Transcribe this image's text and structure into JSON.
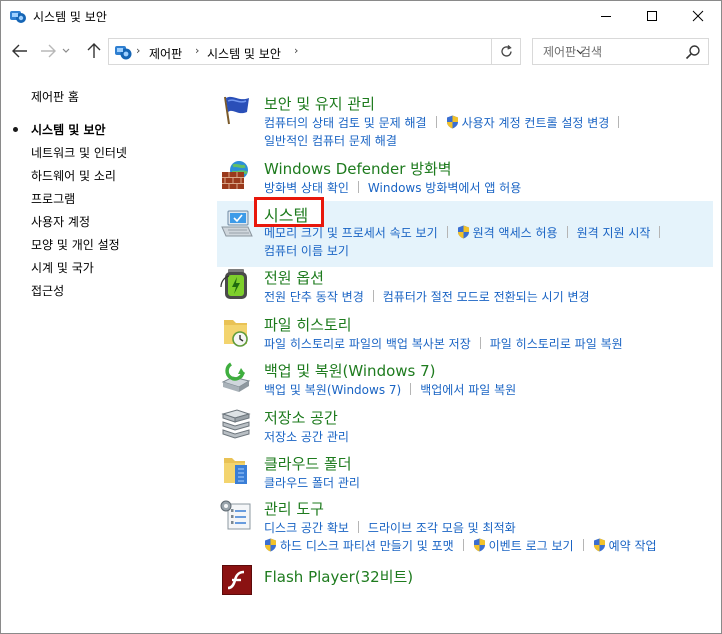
{
  "window": {
    "title": "시스템 및 보안"
  },
  "address": {
    "breadcrumbs": [
      "제어판",
      "시스템 및 보안"
    ],
    "search_placeholder": "제어판 검색"
  },
  "leftnav": {
    "items": [
      {
        "label": "제어판 홈",
        "current": false
      },
      {
        "label": "시스템 및 보안",
        "current": true
      },
      {
        "label": "네트워크 및 인터넷",
        "current": false
      },
      {
        "label": "하드웨어 및 소리",
        "current": false
      },
      {
        "label": "프로그램",
        "current": false
      },
      {
        "label": "사용자 계정",
        "current": false
      },
      {
        "label": "모양 및 개인 설정",
        "current": false
      },
      {
        "label": "시계 및 국가",
        "current": false
      },
      {
        "label": "접근성",
        "current": false
      }
    ]
  },
  "categories": [
    {
      "title": "보안 및 유지 관리",
      "icon": "flag-icon",
      "links": [
        [
          "컴퓨터의 상태 검토 및 문제 해결",
          "사용자 계정 컨트롤 설정 변경"
        ],
        [
          "일반적인 컴퓨터 문제 해결"
        ]
      ]
    },
    {
      "title": "Windows Defender 방화벽",
      "icon": "firewall-icon",
      "links": [
        [
          "방화벽 상태 확인",
          "Windows 방화벽에서 앱 허용"
        ]
      ]
    },
    {
      "title": "시스템",
      "icon": "computer-icon",
      "links": [
        [
          "메모리 크기 및 프로세서 속도 보기",
          "원격 액세스 허용",
          "원격 지원 시작"
        ],
        [
          "컴퓨터 이름 보기"
        ]
      ]
    },
    {
      "title": "전원 옵션",
      "icon": "battery-icon",
      "links": [
        [
          "전원 단추 동작 변경",
          "컴퓨터가 절전 모드로 전환되는 시기 변경"
        ]
      ]
    },
    {
      "title": "파일 히스토리",
      "icon": "file-history-icon",
      "links": [
        [
          "파일 히스토리로 파일의 백업 복사본 저장",
          "파일 히스토리로 파일 복원"
        ]
      ]
    },
    {
      "title": "백업 및 복원(Windows 7)",
      "icon": "backup-icon",
      "links": [
        [
          "백업 및 복원(Windows 7)",
          "백업에서 파일 복원"
        ]
      ]
    },
    {
      "title": "저장소 공간",
      "icon": "storage-icon",
      "links": [
        [
          "저장소 공간 관리"
        ]
      ]
    },
    {
      "title": "클라우드 폴더",
      "icon": "cloud-folder-icon",
      "links": [
        [
          "클라우드 폴더 관리"
        ]
      ]
    },
    {
      "title": "관리 도구",
      "icon": "admin-tools-icon",
      "links": [
        [
          "디스크 공간 확보",
          "드라이브 조각 모음 및 최적화"
        ],
        [
          "하드 디스크 파티션 만들기 및 포맷",
          "이벤트 로그 보기",
          "예약 작업"
        ]
      ]
    },
    {
      "title": "Flash Player(32비트)",
      "icon": "flash-icon",
      "links": []
    }
  ],
  "colors": {
    "category_title": "#1e7b1e",
    "link": "#1a64c4",
    "highlight_bg": "#e5f3fb",
    "selection_box": "#e8170b"
  }
}
